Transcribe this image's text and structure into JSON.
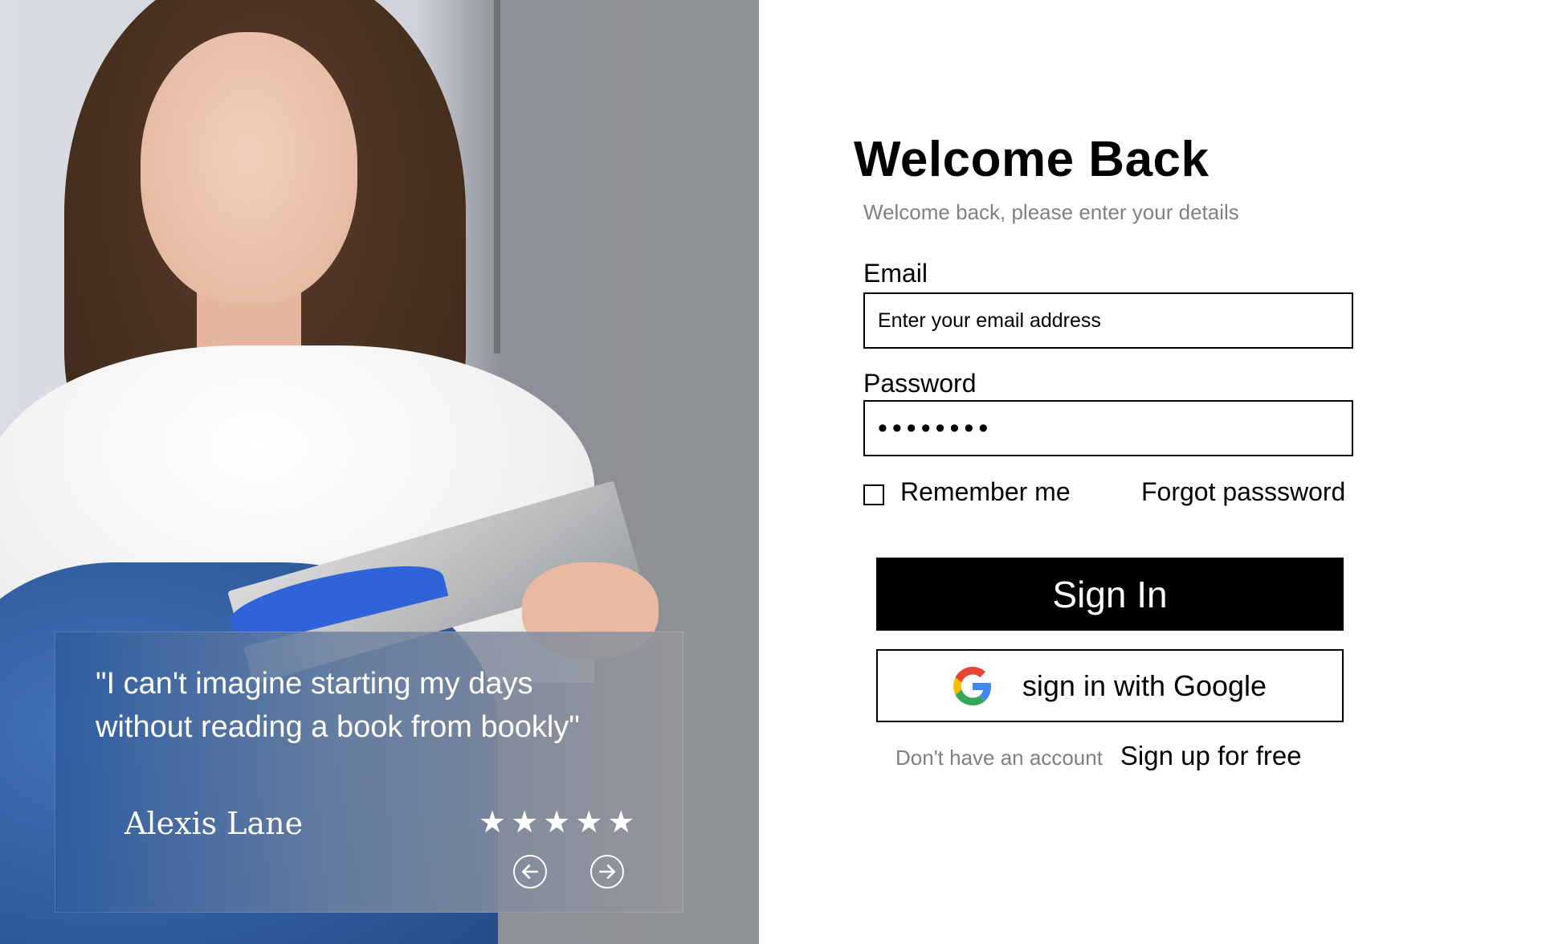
{
  "hero": {
    "testimonial": {
      "quote": "\"I can't imagine starting my days without reading a book from bookly\"",
      "author": "Alexis Lane",
      "rating": 5,
      "stars": "★★★★★"
    }
  },
  "form": {
    "title": "Welcome Back",
    "subtitle": "Welcome back, please enter your details",
    "email_label": "Email",
    "email_placeholder": "Enter your email address",
    "password_label": "Password",
    "password_value": "••••••••",
    "remember_label": "Remember me",
    "remember_checked": false,
    "forgot_label": "Forgot passsword",
    "signin_label": "Sign In",
    "google_label": "sign in with Google",
    "no_account_text": "Don't have an account",
    "signup_label": "Sign up for free"
  },
  "colors": {
    "primary": "#000000",
    "muted_text": "#808080",
    "card_blue": "#2d5ca0"
  }
}
